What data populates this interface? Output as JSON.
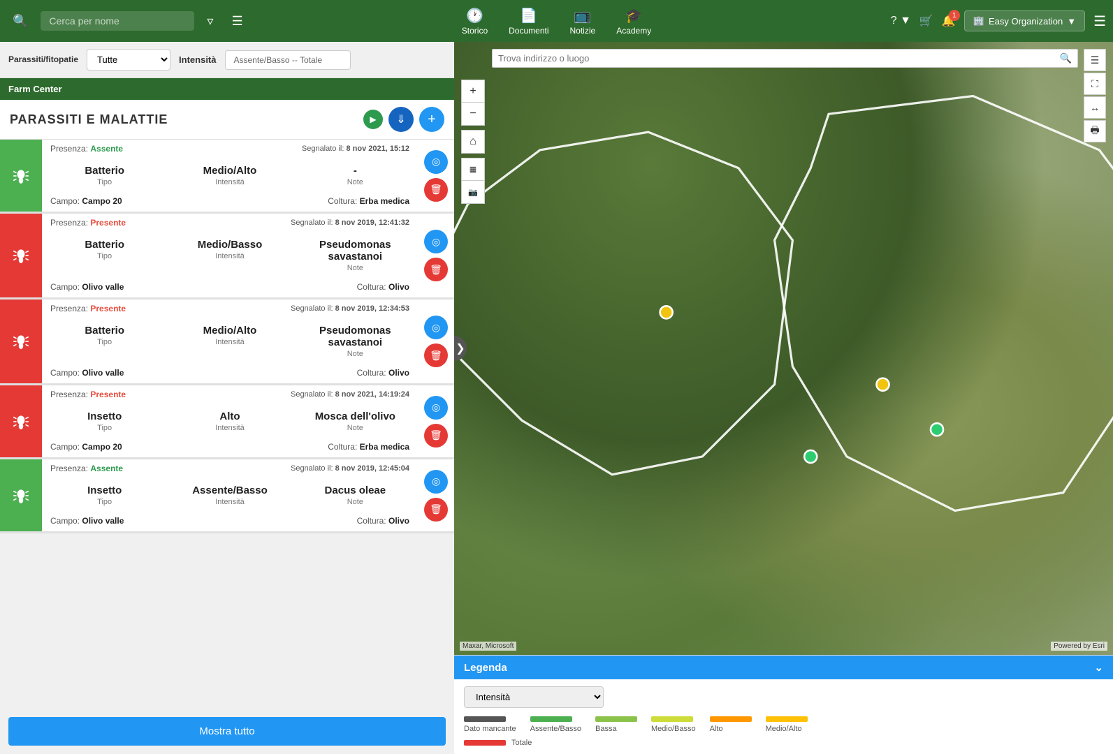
{
  "topNav": {
    "search_placeholder": "Cerca per nome",
    "storico_label": "Storico",
    "documenti_label": "Documenti",
    "notizie_label": "Notizie",
    "academy_label": "Academy",
    "org_label": "Easy Organization",
    "notification_count": "1"
  },
  "filterRow": {
    "parassiti_label": "Parassiti/fitopatie",
    "tutte_option": "Tutte",
    "intensita_label": "Intensità",
    "range_label": "Assente/Basso -- Totale"
  },
  "panelTitle": "PARASSITI E MALATTIE",
  "pestList": [
    {
      "presenza": "Assente",
      "presenza_class": "assente",
      "segnalato": "8 nov 2021, 15:12",
      "tipo_value": "Batterio",
      "tipo_label": "Tipo",
      "intensita_value": "Medio/Alto",
      "intensita_label": "Intensità",
      "note_value": "-",
      "note_label": "Note",
      "campo": "Campo 20",
      "coltura": "Erba medica",
      "icon_class": "green"
    },
    {
      "presenza": "Presente",
      "presenza_class": "presente",
      "segnalato": "8 nov 2019, 12:41:32",
      "tipo_value": "Batterio",
      "tipo_label": "Tipo",
      "intensita_value": "Medio/Basso",
      "intensita_label": "Intensità",
      "note_value": "Pseudomonas savastanoi",
      "note_label": "Note",
      "campo": "Olivo valle",
      "coltura": "Olivo",
      "icon_class": "red"
    },
    {
      "presenza": "Presente",
      "presenza_class": "presente",
      "segnalato": "8 nov 2019, 12:34:53",
      "tipo_value": "Batterio",
      "tipo_label": "Tipo",
      "intensita_value": "Medio/Alto",
      "intensita_label": "Intensità",
      "note_value": "Pseudomonas savastanoi",
      "note_label": "Note",
      "campo": "Olivo valle",
      "coltura": "Olivo",
      "icon_class": "red"
    },
    {
      "presenza": "Presente",
      "presenza_class": "presente",
      "segnalato": "8 nov 2021, 14:19:24",
      "tipo_value": "Insetto",
      "tipo_label": "Tipo",
      "intensita_value": "Alto",
      "intensita_label": "Intensità",
      "note_value": "Mosca dell'olivo",
      "note_label": "Note",
      "campo": "Campo 20",
      "coltura": "Erba medica",
      "icon_class": "red"
    },
    {
      "presenza": "Assente",
      "presenza_class": "assente",
      "segnalato": "8 nov 2019, 12:45:04",
      "tipo_value": "Insetto",
      "tipo_label": "Tipo",
      "intensita_value": "Assente/Basso",
      "intensita_label": "Intensità",
      "note_value": "Dacus oleae",
      "note_label": "Note",
      "campo": "Olivo valle",
      "coltura": "Olivo",
      "icon_class": "green"
    }
  ],
  "mostraTutto": "Mostra tutto",
  "map": {
    "search_placeholder": "Trova indirizzo o luogo",
    "attribution": "Maxar, Microsoft",
    "attribution_right": "Powered by Esri"
  },
  "legend": {
    "title": "Legenda",
    "select_label": "Intensità",
    "items": [
      {
        "label": "Dato mancante",
        "color": "#555555"
      },
      {
        "label": "Assente/Basso",
        "color": "#4caf50"
      },
      {
        "label": "Bassa",
        "color": "#8bc34a"
      },
      {
        "label": "Medio/Basso",
        "color": "#cddc39"
      },
      {
        "label": "Alto",
        "color": "#ff9800"
      },
      {
        "label": "Medio/Alto",
        "color": "#ffc107"
      }
    ],
    "totale_label": "Totale",
    "totale_color": "#e53935"
  }
}
